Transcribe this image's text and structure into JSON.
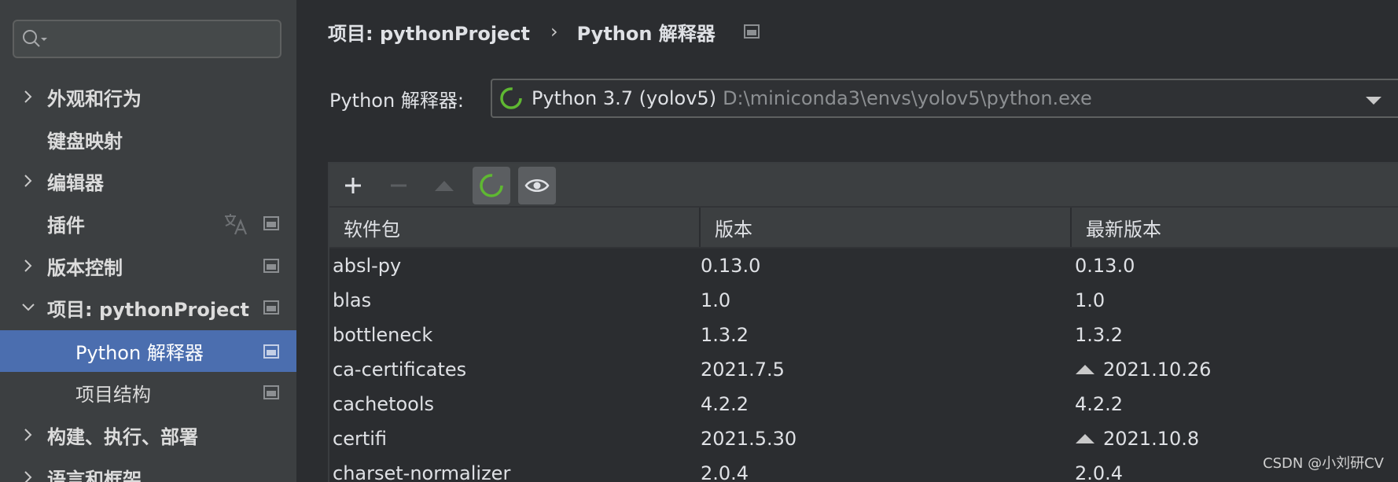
{
  "sidebar": {
    "search": {
      "placeholder": "",
      "value": ""
    },
    "items": [
      {
        "label": "外观和行为",
        "expandable": true,
        "expanded": false
      },
      {
        "label": "键盘映射",
        "expandable": false
      },
      {
        "label": "编辑器",
        "expandable": true,
        "expanded": false
      },
      {
        "label": "插件",
        "expandable": false
      },
      {
        "label": "版本控制",
        "expandable": true,
        "expanded": false
      },
      {
        "label": "项目: pythonProject",
        "expandable": true,
        "expanded": true
      },
      {
        "label": "Python 解释器",
        "sub": true,
        "selected": true
      },
      {
        "label": "项目结构",
        "sub": true
      },
      {
        "label": "构建、执行、部署",
        "expandable": true,
        "expanded": false
      },
      {
        "label": "语言和框架",
        "expandable": true,
        "expanded": false
      }
    ]
  },
  "breadcrumb": {
    "project": "项目: pythonProject",
    "separator": "›",
    "current": "Python 解释器"
  },
  "interpreter": {
    "label": "Python 解释器:",
    "name": "Python 3.7 (yolov5)",
    "path": "D:\\miniconda3\\envs\\yolov5\\python.exe"
  },
  "table": {
    "headers": [
      "软件包",
      "版本",
      "最新版本"
    ],
    "rows": [
      {
        "package": "absl-py",
        "version": "0.13.0",
        "latest": "0.13.0",
        "upgrade": false
      },
      {
        "package": "blas",
        "version": "1.0",
        "latest": "1.0",
        "upgrade": false
      },
      {
        "package": "bottleneck",
        "version": "1.3.2",
        "latest": "1.3.2",
        "upgrade": false
      },
      {
        "package": "ca-certificates",
        "version": "2021.7.5",
        "latest": "2021.10.26",
        "upgrade": true
      },
      {
        "package": "cachetools",
        "version": "4.2.2",
        "latest": "4.2.2",
        "upgrade": false
      },
      {
        "package": "certifi",
        "version": "2021.5.30",
        "latest": "2021.10.8",
        "upgrade": true
      },
      {
        "package": "charset-normalizer",
        "version": "2.0.4",
        "latest": "2.0.4",
        "upgrade": false
      }
    ]
  },
  "watermark": "CSDN @小刘研CV",
  "colors": {
    "accent": "#4b6eaf",
    "spinner": "#5fb832",
    "background": "#2b2d30",
    "sidebar": "#3c3f41"
  }
}
